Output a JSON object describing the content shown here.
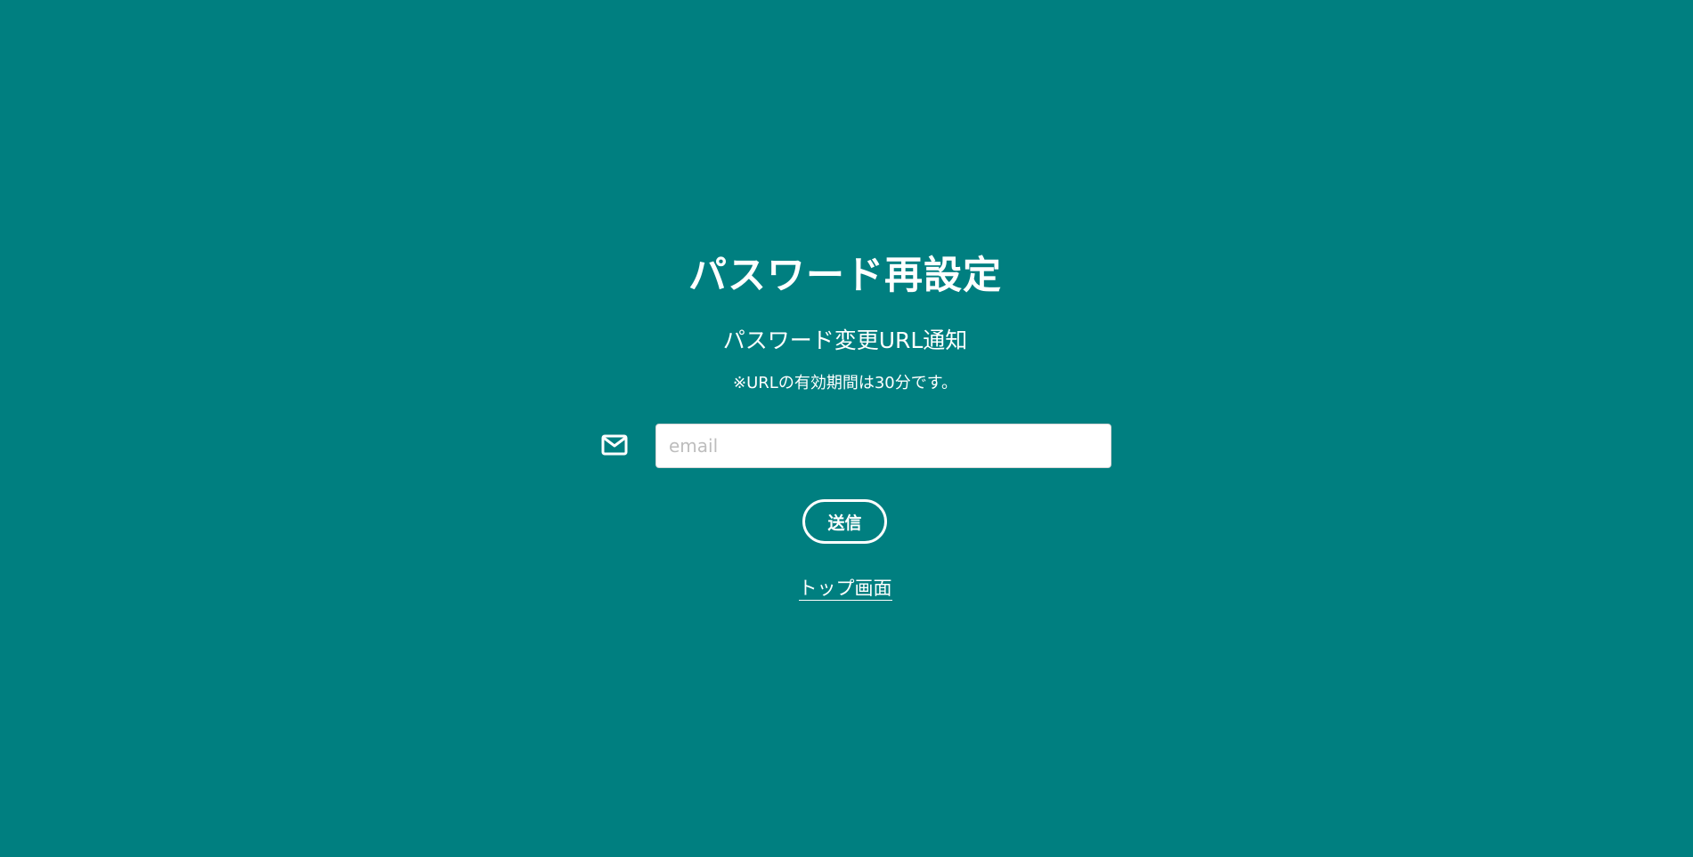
{
  "page": {
    "title": "パスワード再設定",
    "subtitle": "パスワード変更URL通知",
    "note": "※URLの有効期間は30分です。"
  },
  "form": {
    "email_icon": "envelope-icon",
    "email_placeholder": "email",
    "email_value": "",
    "submit_label": "送信"
  },
  "links": {
    "top_page": "トップ画面"
  },
  "colors": {
    "background": "#007f80",
    "text": "#ffffff",
    "input_background": "#ffffff",
    "placeholder": "#bdbdbd"
  }
}
